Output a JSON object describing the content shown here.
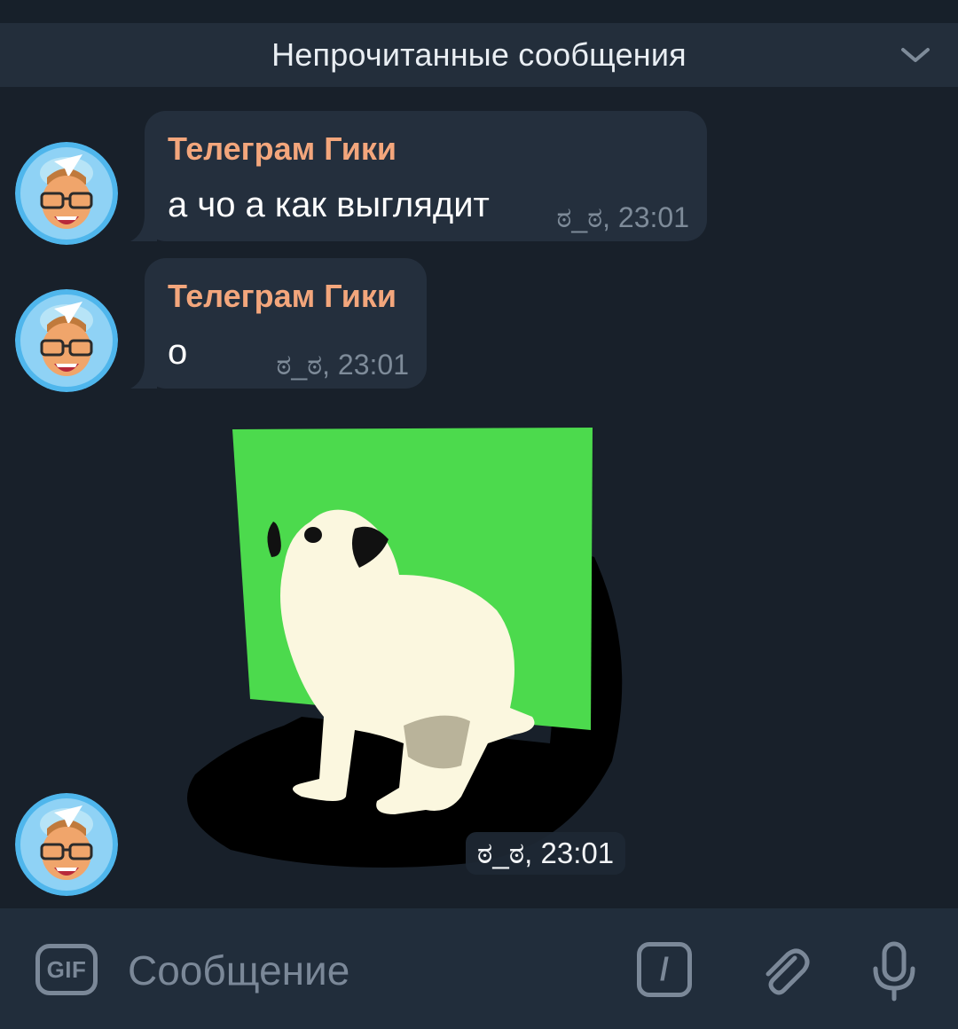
{
  "unread_header": {
    "title": "Непрочитанные сообщения",
    "chevron_icon": "chevron-down-icon"
  },
  "messages": [
    {
      "sender": "Телеграм Гики",
      "text": "а чо а как выглядит",
      "meta": "ಠ_ಠ, 23:01",
      "avatar_icon": "telegram-geek-avatar"
    },
    {
      "sender": "Телеграм Гики",
      "text": "о",
      "meta": "ಠ_ಠ, 23:01",
      "avatar_icon": "telegram-geek-avatar"
    }
  ],
  "sticker": {
    "meta": "ಠ_ಠ, 23:01",
    "avatar_icon": "telegram-geek-avatar",
    "icon": "dog-green-screen-sticker"
  },
  "composer": {
    "gif_label": "GIF",
    "placeholder": "Сообщение",
    "command_label": "/",
    "attach_icon": "paperclip-icon",
    "mic_icon": "microphone-icon"
  },
  "colors": {
    "background": "#18202a",
    "bubble": "#242f3d",
    "sender_name": "#f3a67c",
    "meta": "#7e8b99",
    "composer": "#212d3b"
  }
}
